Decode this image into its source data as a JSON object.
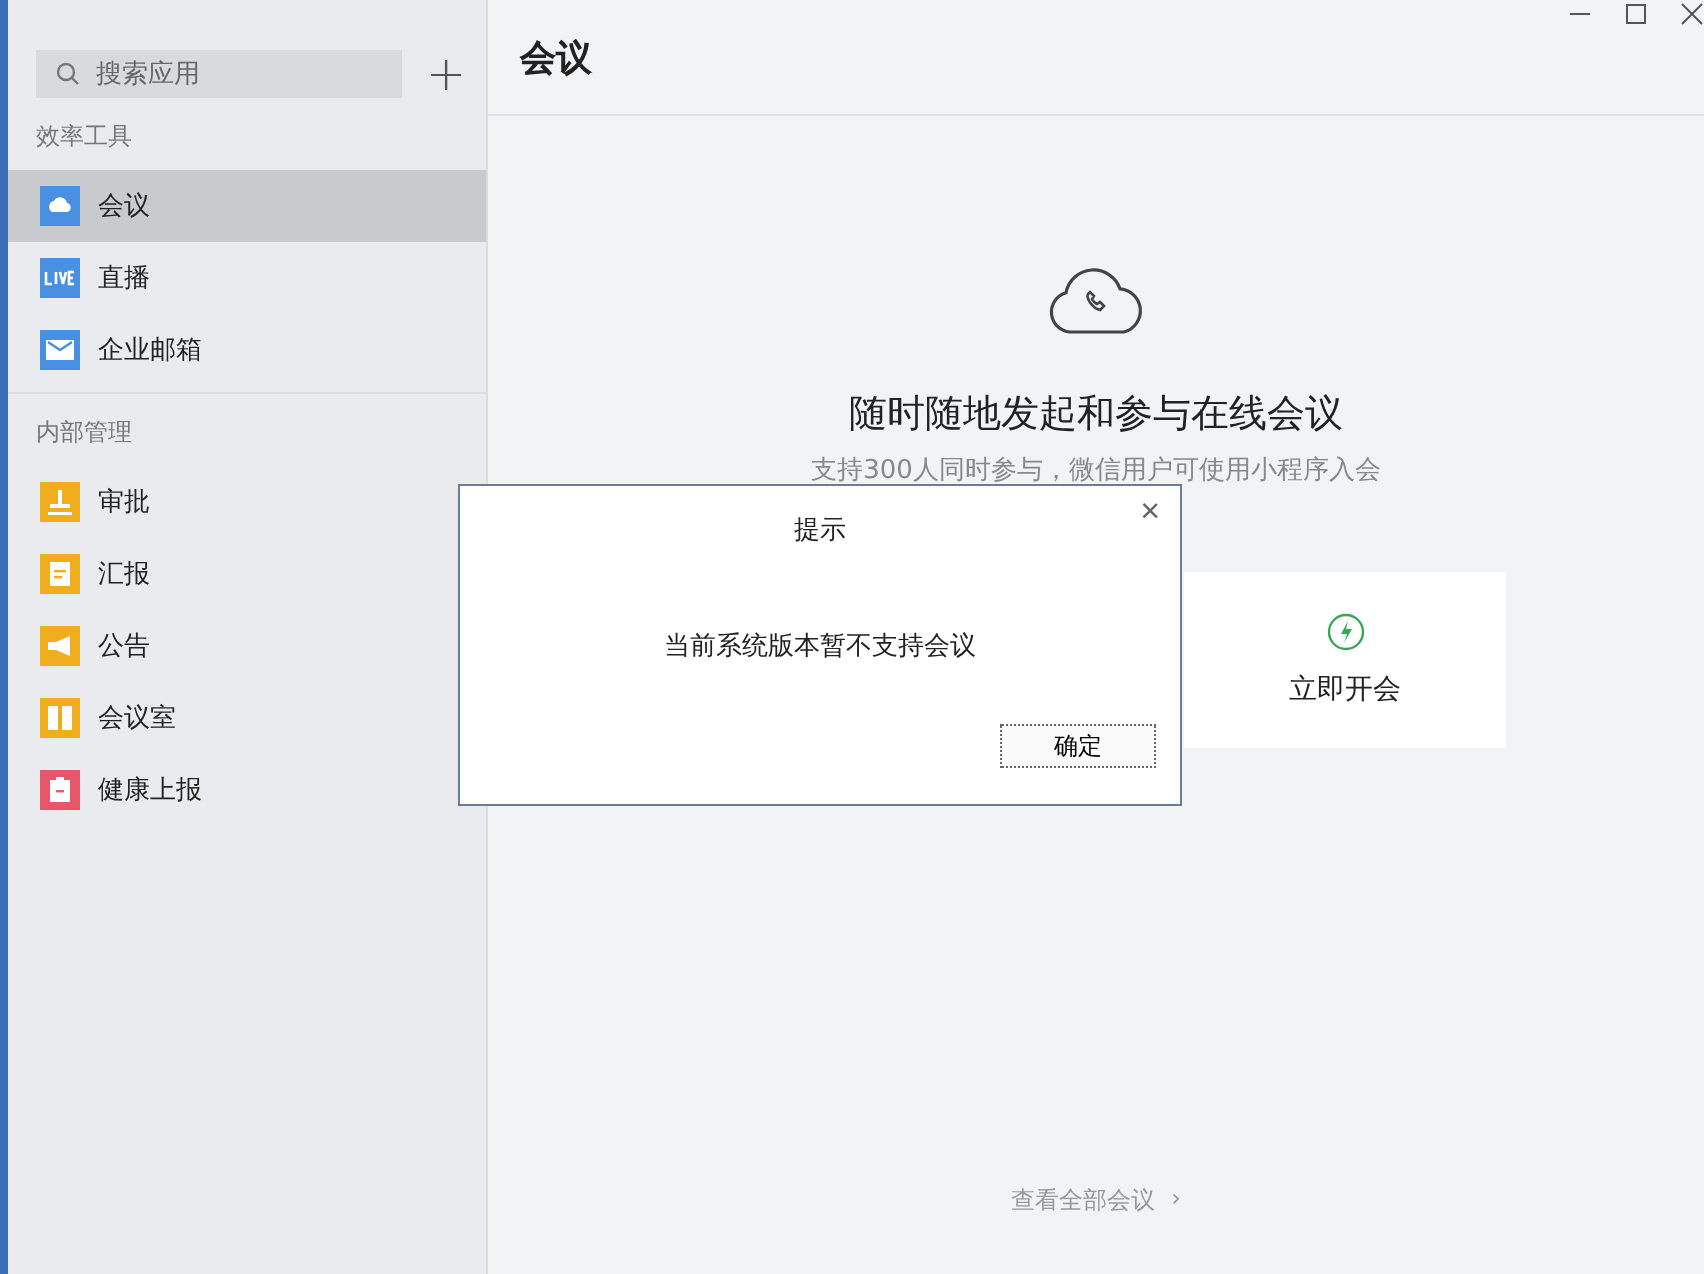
{
  "sidebar": {
    "search": {
      "placeholder": "搜索应用"
    },
    "add_button": "+",
    "sections": [
      {
        "title": "效率工具",
        "items": [
          {
            "label": "会议",
            "kind": "cloud",
            "color": "#4a90e2",
            "selected": true
          },
          {
            "label": "直播",
            "kind": "live",
            "color": "#4a90e2",
            "selected": false
          },
          {
            "label": "企业邮箱",
            "kind": "mail",
            "color": "#4a90e2",
            "selected": false
          }
        ]
      },
      {
        "title": "内部管理",
        "items": [
          {
            "label": "审批",
            "kind": "stamp",
            "color": "#f0ad1e",
            "selected": false
          },
          {
            "label": "汇报",
            "kind": "doc",
            "color": "#f0ad1e",
            "selected": false
          },
          {
            "label": "公告",
            "kind": "horn",
            "color": "#f0ad1e",
            "selected": false
          },
          {
            "label": "会议室",
            "kind": "door",
            "color": "#f0ad1e",
            "selected": false
          },
          {
            "label": "健康上报",
            "kind": "bag",
            "color": "#e8566a",
            "selected": false
          }
        ]
      }
    ]
  },
  "main": {
    "title": "会议",
    "heading": "随时随地发起和参与在线会议",
    "subtitle": "支持300人同时参与，微信用户可使用小程序入会",
    "cards": [
      {
        "label": "立即开会"
      }
    ],
    "footer_link": "查看全部会议",
    "footer_arrow": "›"
  },
  "dialog": {
    "title": "提示",
    "close": "×",
    "message": "当前系统版本暂不支持会议",
    "button": "确定"
  }
}
